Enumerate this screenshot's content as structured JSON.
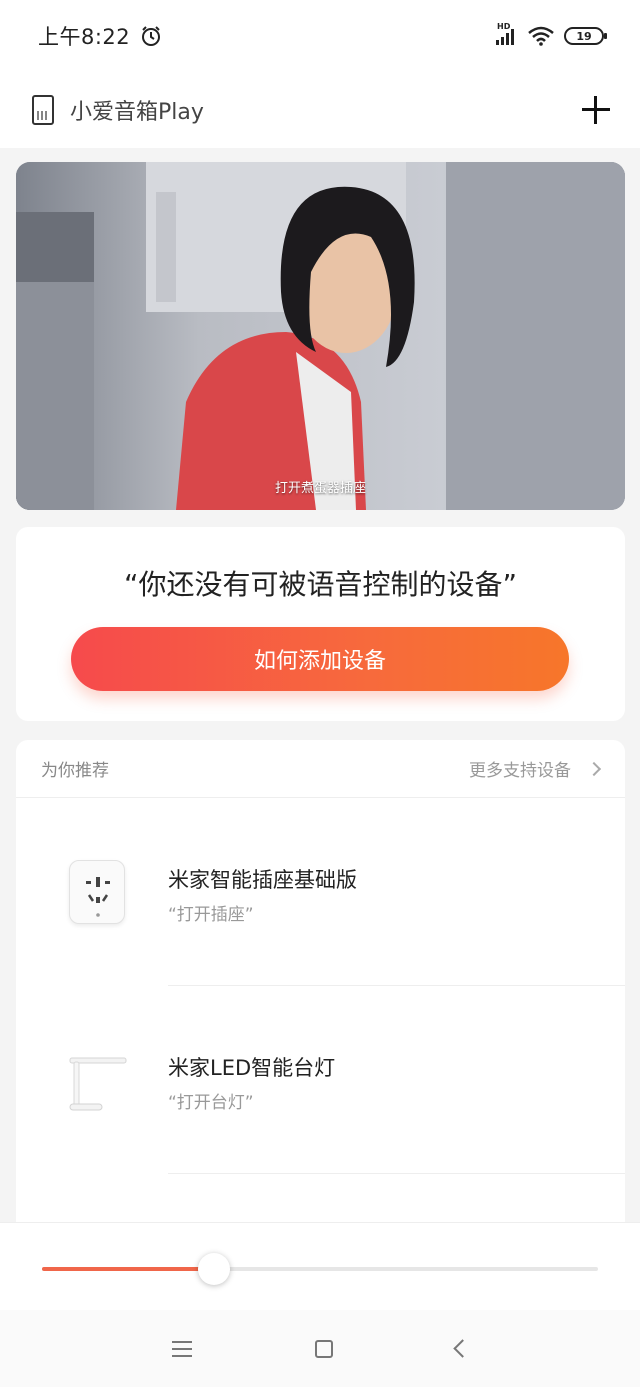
{
  "status_bar": {
    "time": "上午8:22",
    "hd_label": "HD",
    "battery": "19"
  },
  "header": {
    "device_name": "小爱音箱Play",
    "device_icon": "speaker-icon",
    "add_icon": "plus-icon"
  },
  "video": {
    "caption": "打开煮蛋器插座"
  },
  "prompt": {
    "text": "“你还没有可被语音控制的设备”",
    "button_label": "如何添加设备"
  },
  "recommend": {
    "title": "为你推荐",
    "more_label": "更多支持设备",
    "items": [
      {
        "name": "米家智能插座基础版",
        "command": "“打开插座”",
        "icon": "smart-socket-icon"
      },
      {
        "name": "米家LED智能台灯",
        "command": "“打开台灯”",
        "icon": "desk-lamp-icon"
      }
    ]
  },
  "player": {
    "progress": 0.31
  },
  "nav": {
    "menu_icon": "menu-icon",
    "home_icon": "home-square-icon",
    "back_icon": "back-icon"
  },
  "colors": {
    "accent_start": "#f64a4c",
    "accent_end": "#f7762a",
    "progress": "#f0664a"
  }
}
